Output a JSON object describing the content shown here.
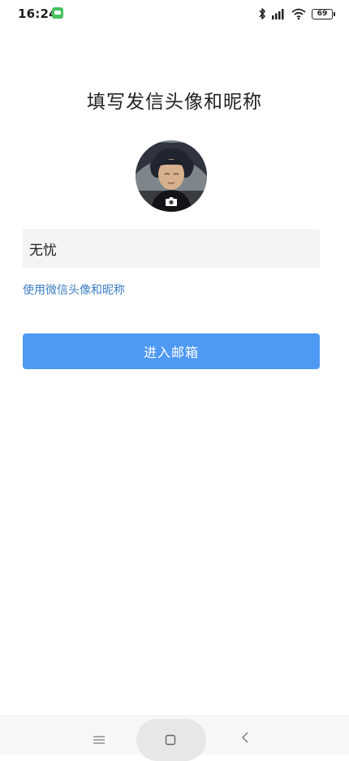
{
  "status_bar": {
    "time": "16:24",
    "battery": "69"
  },
  "title": "填写发信头像和昵称",
  "nickname": {
    "value": "无忧"
  },
  "wechat_link": "使用微信头像和昵称",
  "enter_button": "进入邮箱",
  "icons": {
    "status": [
      "app-notification-icon",
      "bluetooth-icon",
      "signal-icon",
      "wifi-icon",
      "battery-icon"
    ],
    "avatar": "camera-icon",
    "navigation": [
      "menu-icon",
      "home-icon",
      "back-icon"
    ]
  },
  "colors": {
    "button": "#4e99f3",
    "link": "#3a7ec4",
    "input_background": "#f4f4f4"
  }
}
